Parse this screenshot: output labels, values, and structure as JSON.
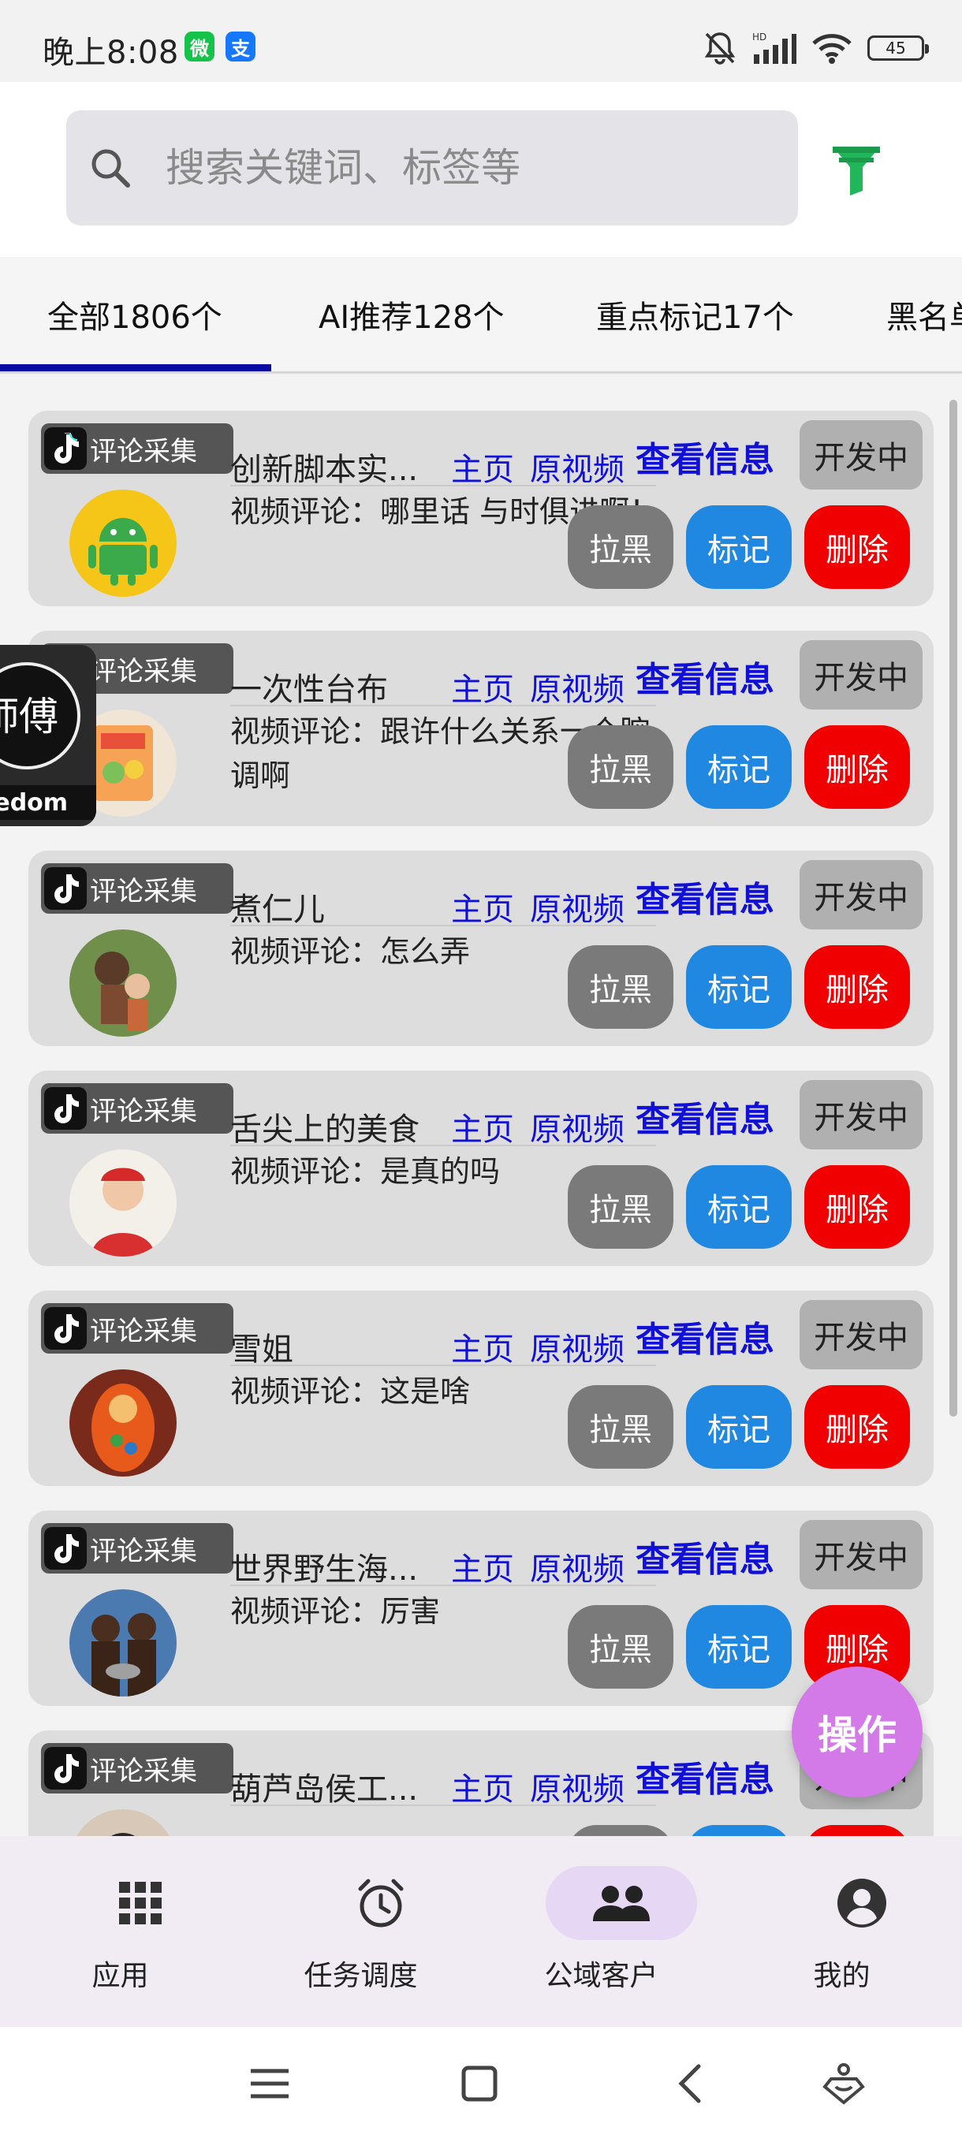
{
  "status_bar": {
    "time": "晚上8:08",
    "app_badges": [
      {
        "icon": "wechat-icon",
        "glyph": "微",
        "color": "#15c34a"
      },
      {
        "icon": "alipay-icon",
        "glyph": "支",
        "color": "#1677ff"
      }
    ],
    "battery": "45"
  },
  "search": {
    "placeholder": "搜索关键词、标签等"
  },
  "tabs": [
    {
      "label": "全部1806个",
      "active": true
    },
    {
      "label": "AI推荐128个",
      "active": false
    },
    {
      "label": "重点标记17个",
      "active": false
    },
    {
      "label": "黑名单",
      "active": false
    }
  ],
  "card_common": {
    "source_label": "评论采集",
    "home_link": "主页",
    "video_link": "原视频",
    "view_info": "查看信息",
    "dev_status": "开发中",
    "block_label": "拉黑",
    "mark_label": "标记",
    "delete_label": "删除"
  },
  "cards": [
    {
      "nickname": "创新脚本实...",
      "comment": "视频评论：哪里话 与时俱进啊！"
    },
    {
      "nickname": "一次性台布",
      "comment": "视频评论：跟许什么关系一个腔调啊"
    },
    {
      "nickname": "煮仁儿",
      "comment": "视频评论：怎么弄"
    },
    {
      "nickname": "舌尖上的美食",
      "comment": "视频评论：是真的吗"
    },
    {
      "nickname": "雪姐",
      "comment": "视频评论：这是啥"
    },
    {
      "nickname": "世界野生海...",
      "comment": "视频评论：厉害"
    },
    {
      "nickname": "葫芦岛侯工...",
      "comment": ""
    }
  ],
  "floating_avatar": {
    "text": "師傅",
    "sub": "eedom"
  },
  "fab": {
    "label": "操作"
  },
  "bottom_nav": [
    {
      "label": "应用",
      "icon": "grid-apps-icon",
      "active": false
    },
    {
      "label": "任务调度",
      "icon": "alarm-clock-icon",
      "active": false
    },
    {
      "label": "公域客户",
      "icon": "people-icon",
      "active": true
    },
    {
      "label": "我的",
      "icon": "account-circle-icon",
      "active": false
    }
  ],
  "colors": {
    "link_blue": "#1010d8",
    "mark_blue": "#2088e0",
    "delete_red": "#f00000",
    "fab_purple": "#d379e8",
    "tab_indicator": "#0a0aa0",
    "filter_green": "#21b65a"
  }
}
